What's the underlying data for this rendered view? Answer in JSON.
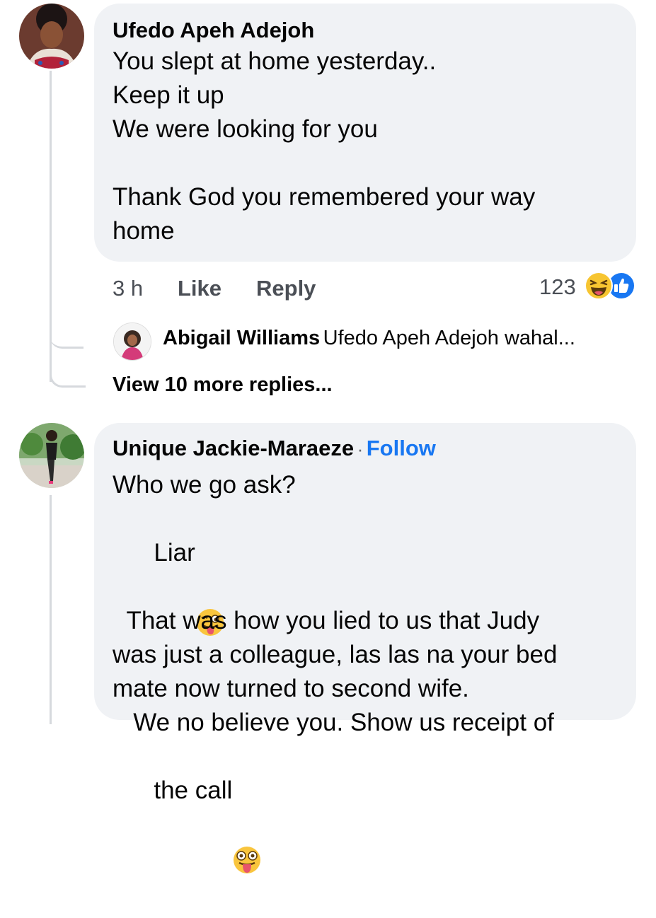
{
  "comment1": {
    "author": "Ufedo Apeh Adejoh",
    "lines": [
      "You slept at home yesterday..",
      "Keep it up",
      "We were looking for you",
      "",
      "Thank God you remembered your way",
      "home"
    ],
    "time": "3 h",
    "like_label": "Like",
    "reply_label": "Reply",
    "reaction_count": "123",
    "reactions": [
      "haha-icon",
      "like-icon"
    ]
  },
  "reply1": {
    "author": "Abigail Williams",
    "text": "Ufedo Apeh Adejoh wahal..."
  },
  "view_more": "View 10 more replies...",
  "comment2": {
    "author": "Unique Jackie-Maraeze",
    "separator": "·",
    "follow_label": "Follow",
    "line1": "Who we go ask?",
    "line2": "Liar",
    "line3": "  That was how you lied to us that Judy",
    "line4": "was just a colleague, las las na your bed",
    "line5": "mate now turned to second wife.",
    "line6": "   We no believe you. Show us receipt of",
    "line7": "the call",
    "emojis": [
      "winking-tongue-emoji",
      "zany-face-emoji"
    ]
  }
}
